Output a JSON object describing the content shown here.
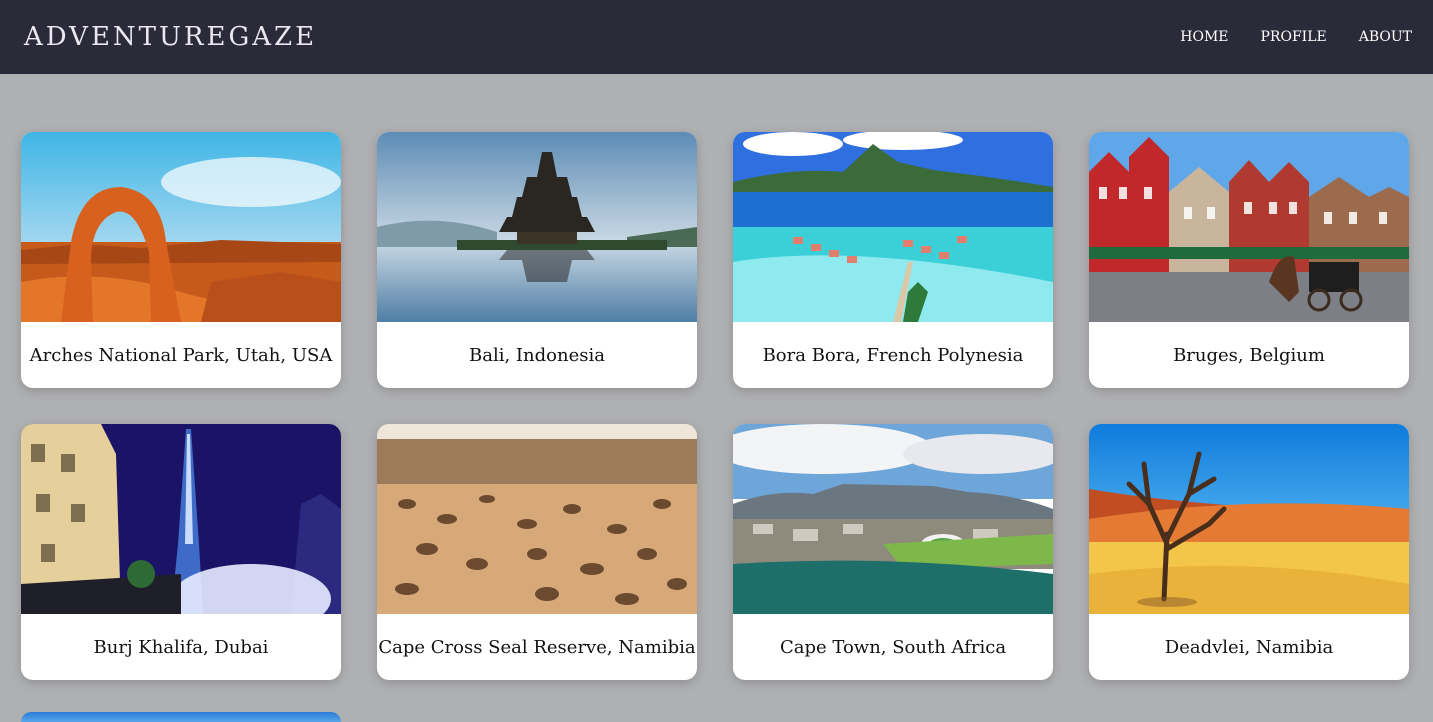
{
  "header": {
    "brand": "ADVENTUREGAZE",
    "nav": [
      {
        "label": "HOME"
      },
      {
        "label": "PROFILE"
      },
      {
        "label": "ABOUT"
      }
    ]
  },
  "destinations": [
    {
      "name": "Arches National Park, Utah, USA",
      "image": "red-arch-desert"
    },
    {
      "name": "Bali, Indonesia",
      "image": "temple-lake-reflection"
    },
    {
      "name": "Bora Bora, French Polynesia",
      "image": "lagoon-overwater-bungalows"
    },
    {
      "name": "Bruges, Belgium",
      "image": "gabled-houses-horse-carriage"
    },
    {
      "name": "Burj Khalifa, Dubai",
      "image": "skyscraper-night-fountain"
    },
    {
      "name": "Cape Cross Seal Reserve, Namibia",
      "image": "seal-colony-beach"
    },
    {
      "name": "Cape Town, South Africa",
      "image": "aerial-city-table-mountain"
    },
    {
      "name": "Deadvlei, Namibia",
      "image": "dead-tree-dunes"
    }
  ]
}
